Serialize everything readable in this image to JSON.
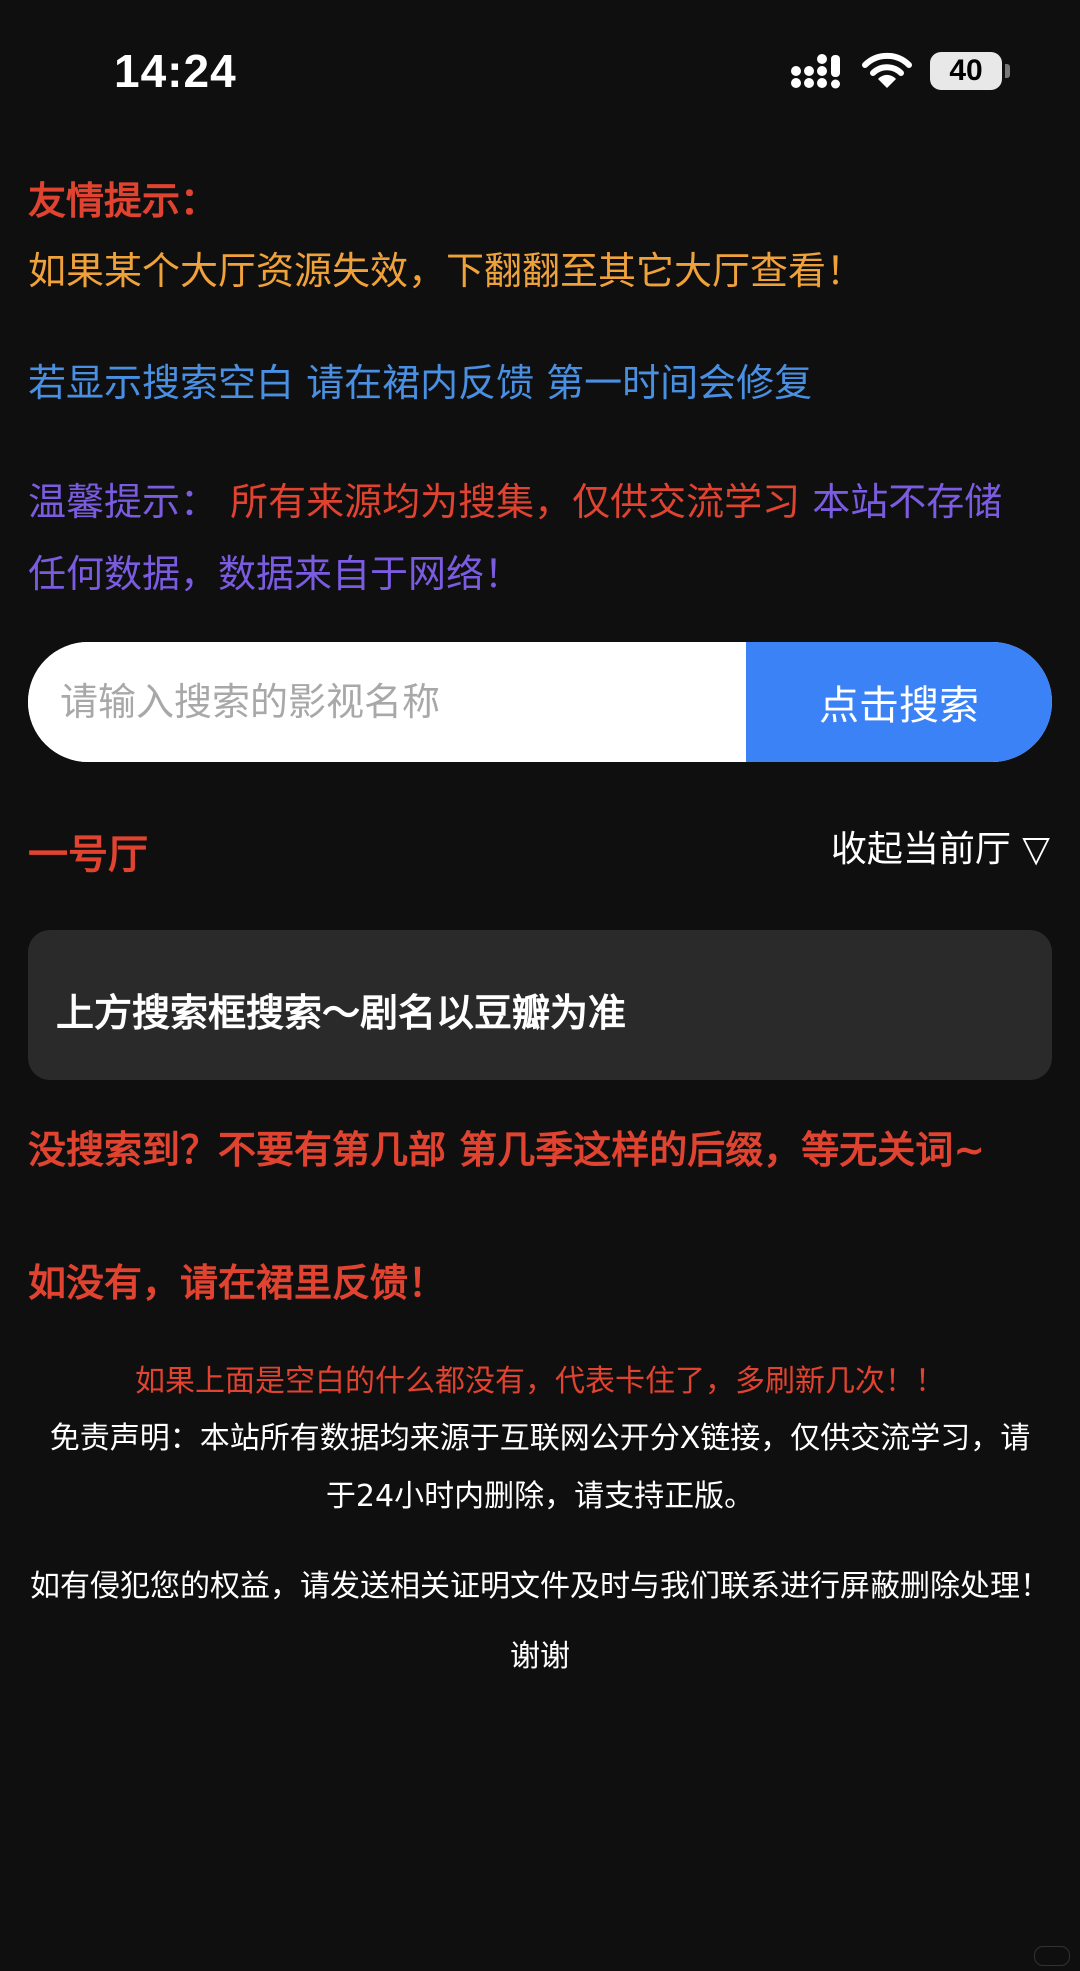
{
  "status_bar": {
    "time": "14:24",
    "battery": "40",
    "icons": [
      "signal-icon",
      "wifi-icon",
      "battery-icon"
    ]
  },
  "tips": {
    "title": "友情提示：",
    "text": "如果某个大厅资源失效，下翻翻至其它大厅查看！",
    "blue_text": "若显示搜索空白 请在裙内反馈 第一时间会修复",
    "warm_label": "温馨提示：",
    "warm_red": "所有来源均为搜集，仅供交流学习",
    "warm_rest": " 本站不存储任何数据，数据来自于网络！"
  },
  "search": {
    "placeholder": "请输入搜索的影视名称",
    "value": "",
    "button_label": "点击搜索"
  },
  "hall": {
    "title": "一号厅",
    "collapse_label": "收起当前厅 ▽",
    "card_text": "上方搜索框搜索～剧名以豆瓣为准"
  },
  "notices": {
    "not_found": "没搜索到？不要有第几部 第几季这样的后缀，等无关词~",
    "feedback": "如没有，请在裙里反馈！",
    "refresh": "如果上面是空白的什么都没有，代表卡住了，多刷新几次！！",
    "disclaimer": "免责声明：本站所有数据均来源于互联网公开分X链接，仅供交流学习，请于24小时内删除，请支持正版。",
    "infringe": "如有侵犯您的权益，请发送相关证明文件及时与我们联系进行屏蔽删除处理！谢谢"
  },
  "colors": {
    "background": "#0f0f10",
    "red": "#e0432f",
    "orange": "#f0a23a",
    "blue": "#4a90e2",
    "purple": "#7b5ce0",
    "button_blue": "#3b82f6",
    "card": "#2a2a2b"
  }
}
